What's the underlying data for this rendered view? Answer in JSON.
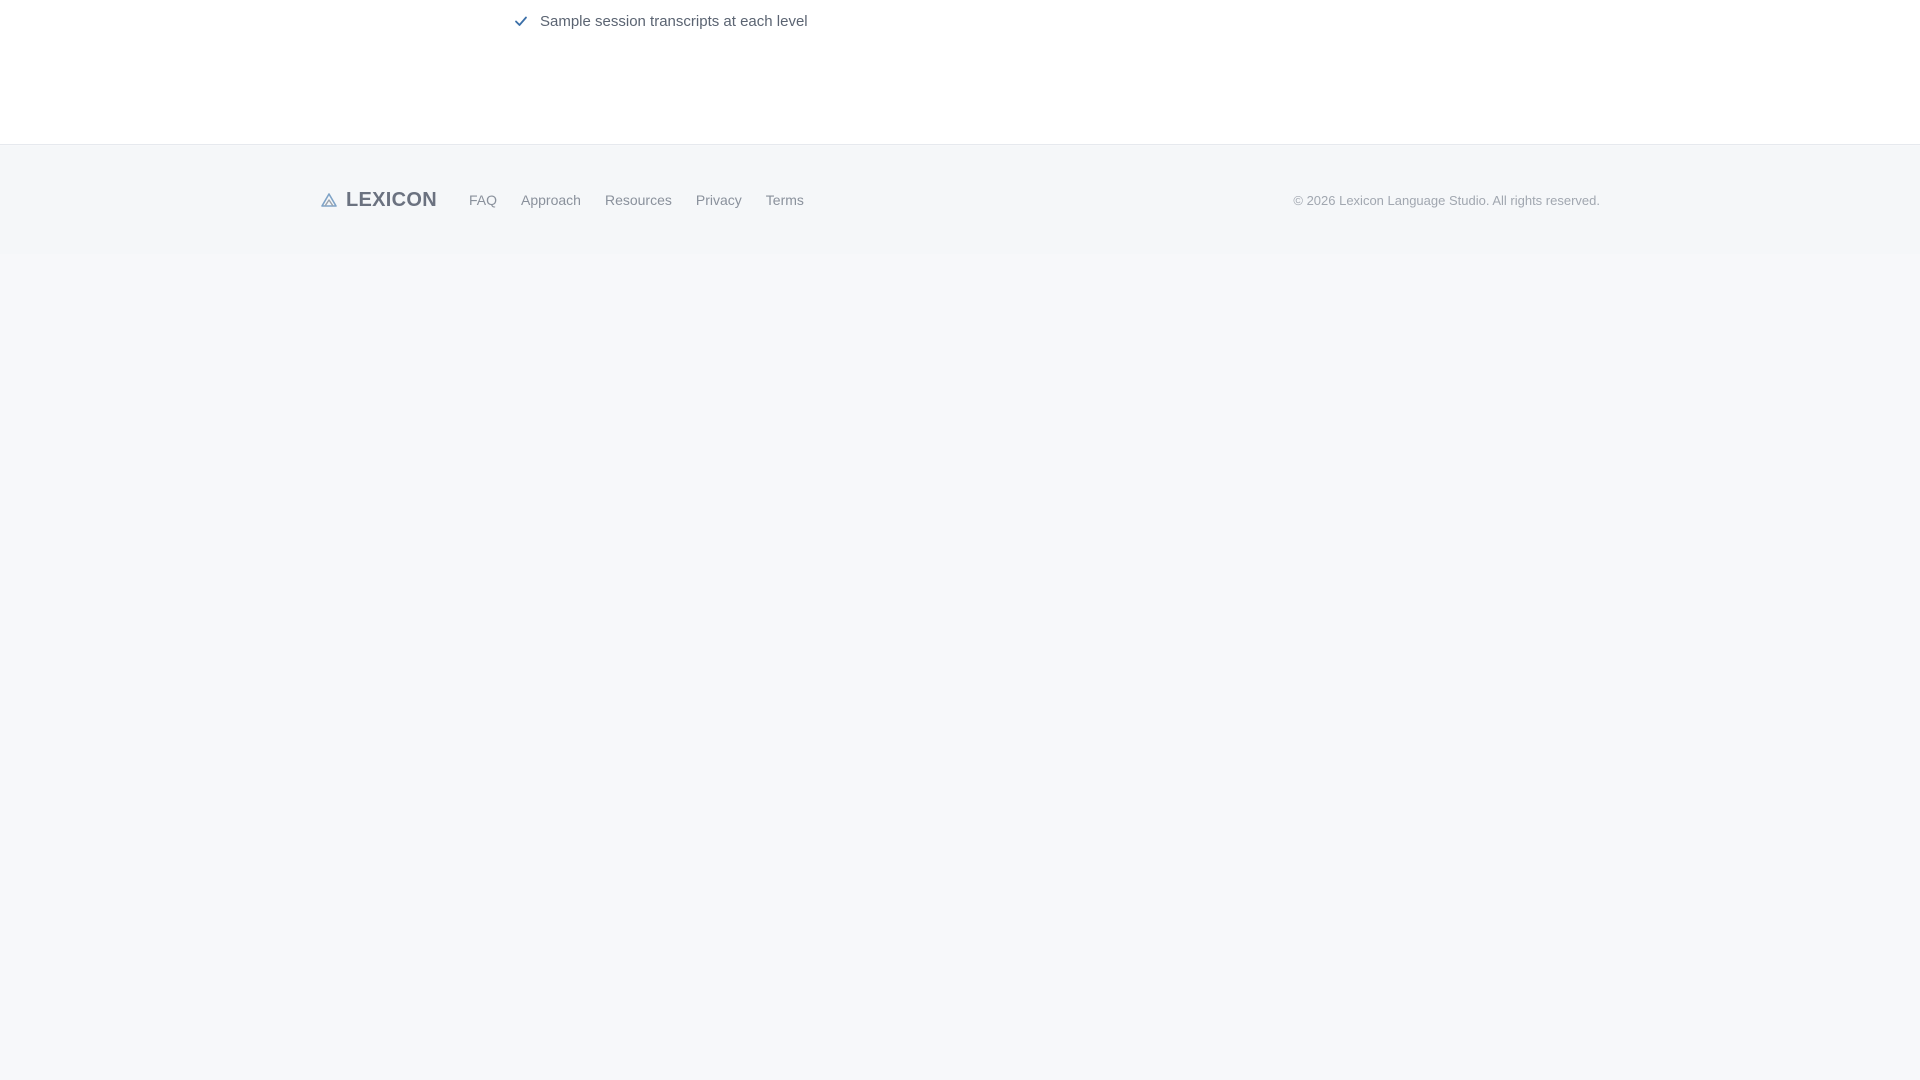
{
  "features": {
    "item_text": "Sample session transcripts at each level",
    "icon": "check-icon",
    "icon_color": "#3b6fa8"
  },
  "footer": {
    "brand": {
      "name": "LEXICON",
      "icon": "mountain-logo-icon"
    },
    "links": [
      {
        "label": "FAQ"
      },
      {
        "label": "Approach"
      },
      {
        "label": "Resources"
      },
      {
        "label": "Privacy"
      },
      {
        "label": "Terms"
      }
    ],
    "copyright": "© 2026 Lexicon Language Studio. All rights reserved."
  }
}
